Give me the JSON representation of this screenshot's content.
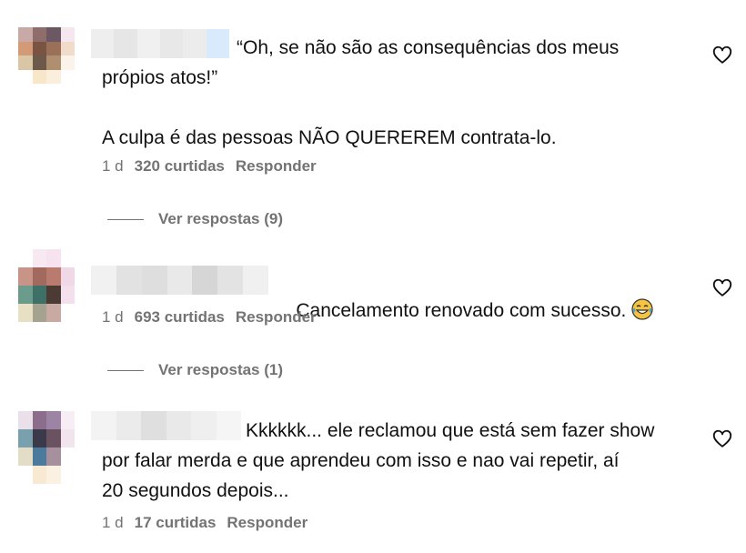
{
  "comments": [
    {
      "text": "“Oh, se não são as consequências dos meus\nprópios atos!”\n\nA culpa é das pessoas NÃO QUEREREM contrata-lo.",
      "time": "1 d",
      "likes": "320 curtidas",
      "reply_label": "Responder",
      "view_replies": "Ver respostas (9)"
    },
    {
      "text": "Cancelamento renovado com sucesso. ",
      "emoji_icon": "laughing-tears-emoji-icon",
      "time": "1 d",
      "likes": "693 curtidas",
      "reply_label": "Responder",
      "view_replies": "Ver respostas (1)"
    },
    {
      "text": "Kkkkkk... ele reclamou que está sem fazer show\npor falar merda e que aprendeu com isso e nao vai repetir, aí\n20 segundos depois...",
      "time": "1 d",
      "likes": "17 curtidas",
      "reply_label": "Responder"
    }
  ],
  "icons": {
    "like": "heart-outline-icon"
  },
  "colors": {
    "meta": "#737373",
    "text": "#111111"
  }
}
